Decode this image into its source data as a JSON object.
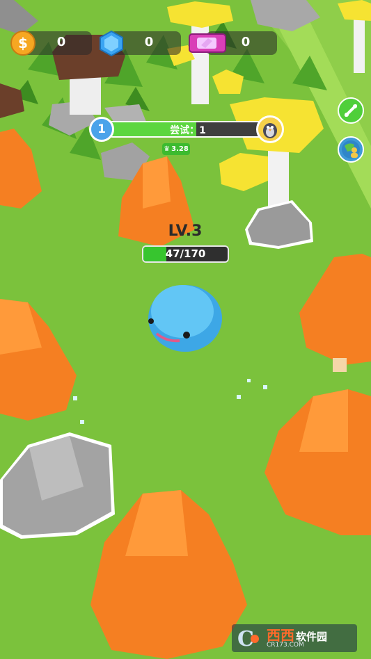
{
  "hud": {
    "coins": "0",
    "gems": "0",
    "tickets": "0"
  },
  "progress": {
    "level_number": "1",
    "attempt_label": "尝试：1",
    "fill_fraction": 0.55,
    "crown_value": "3.28"
  },
  "player": {
    "level_label": "LV.3",
    "xp_label": "47/170",
    "xp_fraction": 0.2765
  },
  "side_buttons": {
    "top": "share-link-icon",
    "bottom": "friends-globe-icon"
  },
  "watermark": {
    "brand": "西西",
    "name": "软件园",
    "url": "CR173.COM"
  },
  "colors": {
    "ground": "#7cc23d",
    "orange_tree": "#f57f22",
    "yellow_mushroom": "#f6e332",
    "slime": "#5cc4f0"
  }
}
